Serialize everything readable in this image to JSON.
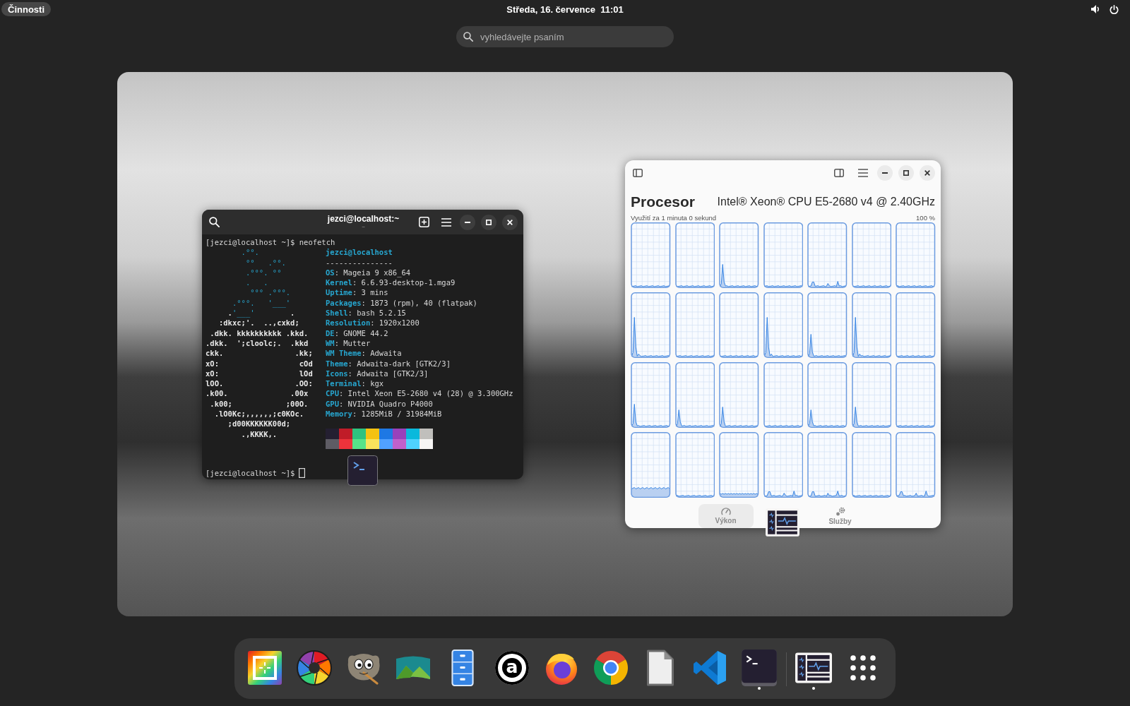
{
  "top_bar": {
    "activities": {
      "label": "Činnosti",
      "selected": true
    },
    "clock": "Středa, 16. července  11:01"
  },
  "search": {
    "placeholder": "vyhledávejte psaním"
  },
  "terminal": {
    "title": "jezci@localhost:~",
    "subtitle": "~",
    "command_line": "[jezci@localhost ~]$ neofetch",
    "logo": [
      [
        {
          "text": "        .°°.",
          "accent": true
        }
      ],
      [
        {
          "text": "         °°   .°°.",
          "accent": true
        }
      ],
      [
        {
          "text": "         .°°°. °°",
          "accent": true
        }
      ],
      [
        {
          "text": "         .   .",
          "accent": true
        }
      ],
      [
        {
          "text": "          °°° .°°°.",
          "accent": true
        }
      ],
      [
        {
          "text": "      .°°°.   '___'",
          "accent": true
        }
      ],
      [
        {
          "text": "     .",
          "accent": false
        },
        {
          "text": "'___'",
          "accent": true
        },
        {
          "text": "        .",
          "accent": false
        }
      ],
      [
        {
          "text": "   :dkxc;'.  ..,cxkd;",
          "accent": false
        }
      ],
      [
        {
          "text": " .dkk. kkkkkkkkkk .kkd.",
          "accent": false
        }
      ],
      [
        {
          "text": ".dkk.  ';cloolc;.  .kkd",
          "accent": false
        }
      ],
      [
        {
          "text": "ckk.                .kk;",
          "accent": false
        }
      ],
      [
        {
          "text": "xO:                  cOd",
          "accent": false
        }
      ],
      [
        {
          "text": "xO:                  lOd",
          "accent": false
        }
      ],
      [
        {
          "text": "lOO.                .OO:",
          "accent": false
        }
      ],
      [
        {
          "text": ".k00.              .00x",
          "accent": false
        }
      ],
      [
        {
          "text": " .k00;            ;00O.",
          "accent": false
        }
      ],
      [
        {
          "text": "  .lO0Kc;,,,,,,;c0KOc.",
          "accent": false
        }
      ],
      [
        {
          "text": "     ;d00KKKKKK00d;",
          "accent": false
        }
      ],
      [
        {
          "text": "        .,KKKK,.",
          "accent": false
        }
      ]
    ],
    "info": [
      {
        "kind": "title",
        "text": "jezci@localhost"
      },
      {
        "kind": "rule",
        "text": "---------------"
      },
      {
        "kind": "field",
        "text": "**OS**: Mageia 9 x86_64"
      },
      {
        "kind": "field",
        "text": "**Kernel**: 6.6.93-desktop-1.mga9"
      },
      {
        "kind": "field",
        "text": "**Uptime**: 3 mins"
      },
      {
        "kind": "field",
        "text": "**Packages**: 1873 (rpm), 40 (flatpak)"
      },
      {
        "kind": "field",
        "text": "**Shell**: bash 5.2.15"
      },
      {
        "kind": "field",
        "text": "**Resolution**: 1920x1200"
      },
      {
        "kind": "field",
        "text": "**DE**: GNOME 44.2"
      },
      {
        "kind": "field",
        "text": "**WM**: Mutter"
      },
      {
        "kind": "field",
        "text": "**WM Theme**: Adwaita"
      },
      {
        "kind": "field",
        "text": "**Theme**: Adwaita-dark [GTK2/3]"
      },
      {
        "kind": "field",
        "text": "**Icons**: Adwaita [GTK2/3]"
      },
      {
        "kind": "field",
        "text": "**Terminal**: kgx"
      },
      {
        "kind": "field",
        "text": "**CPU**: Intel Xeon E5-2680 v4 (28) @ 3.300GHz"
      },
      {
        "kind": "field",
        "text": "**GPU**: NVIDIA Quadro P4000"
      },
      {
        "kind": "field",
        "text": "**Memory**: 1285MiB / 31984MiB"
      }
    ],
    "palette": [
      [
        {
          "color": "#241f31"
        },
        {
          "color": "#c01c28"
        },
        {
          "color": "#2ec27e"
        },
        {
          "color": "#f5c211"
        },
        {
          "color": "#1e78e4"
        },
        {
          "color": "#9841bb"
        },
        {
          "color": "#0ab9dc"
        },
        {
          "color": "#c0bfbc"
        }
      ],
      [
        {
          "color": "#5e5c64"
        },
        {
          "color": "#ed333b"
        },
        {
          "color": "#57e389"
        },
        {
          "color": "#f8e45c"
        },
        {
          "color": "#51a1ff"
        },
        {
          "color": "#c061cb"
        },
        {
          "color": "#4fd2fd"
        },
        {
          "color": "#f6f5f4"
        }
      ]
    ],
    "prompt": "[jezci@localhost ~]$",
    "cursor": {
      "focused": false
    }
  },
  "system_monitor": {
    "heading": "Procesor",
    "cpu_model": "Intel® Xeon® CPU E5-2680 v4 @ 2.40GHz",
    "time_span": "Využití za 1 minuta 0 sekund",
    "scale_max": "100 %",
    "graphs": [
      {
        "kind": "idle"
      },
      {
        "kind": "idle"
      },
      {
        "kind": "spike"
      },
      {
        "kind": "idle"
      },
      {
        "kind": "bumps"
      },
      {
        "kind": "idle"
      },
      {
        "kind": "idle"
      },
      {
        "kind": "peak"
      },
      {
        "kind": "idle"
      },
      {
        "kind": "idle"
      },
      {
        "kind": "peak"
      },
      {
        "kind": "spike"
      },
      {
        "kind": "peak"
      },
      {
        "kind": "idle"
      },
      {
        "kind": "spike"
      },
      {
        "kind": "spike"
      },
      {
        "kind": "spike"
      },
      {
        "kind": "idle"
      },
      {
        "kind": "spike"
      },
      {
        "kind": "spike"
      },
      {
        "kind": "idle"
      },
      {
        "kind": "busy"
      },
      {
        "kind": "idle"
      },
      {
        "kind": "low"
      },
      {
        "kind": "bumps"
      },
      {
        "kind": "bumps"
      },
      {
        "kind": "idle"
      },
      {
        "kind": "bumps"
      }
    ],
    "tabs": [
      {
        "kind": "gauge",
        "label": "Výkon",
        "selected": true
      },
      {
        "kind": "gears",
        "label": "Služby",
        "selected": false
      }
    ]
  },
  "dock": {
    "favorites": [
      {
        "kind": "crosshair",
        "running": false
      },
      {
        "kind": "aperture",
        "running": false
      },
      {
        "kind": "creature",
        "running": false
      },
      {
        "kind": "mountains",
        "running": false
      },
      {
        "kind": "cabinet",
        "running": false
      },
      {
        "kind": "letter",
        "glyph": "a",
        "running": false
      },
      {
        "kind": "globe",
        "running": false
      },
      {
        "kind": "wheel",
        "running": false
      },
      {
        "kind": "document",
        "running": false
      },
      {
        "kind": "ribbon",
        "running": false
      },
      {
        "kind": "terminal",
        "running": true
      }
    ],
    "running_apps": [
      {
        "kind": "monitor",
        "running": true
      }
    ]
  }
}
